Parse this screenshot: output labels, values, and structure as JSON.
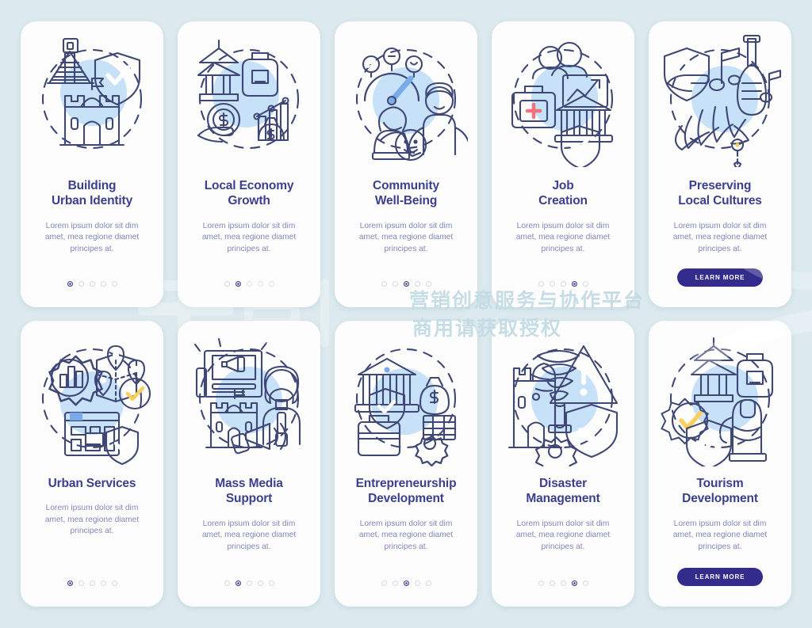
{
  "background_color": "#dceaef",
  "theme": {
    "title_color": "#3b3f8f",
    "body_color": "#8288b8",
    "button_color": "#342c8c",
    "card_color": "#fdfdfd",
    "dot_active_color": "#3b3f8f",
    "dot_inactive_color": "#d5d8e4",
    "accent_yellow": "#f9cf5e",
    "accent_blue": "#76a9ea",
    "accent_lightblue": "#bcdcf7",
    "accent_red": "#f2717a"
  },
  "body_text": "Lorem ipsum dolor sit dim\namet, mea regione diamet\nprincipes at.",
  "learn_more_label": "LEARN MORE",
  "dots_total": 5,
  "cards": [
    {
      "row": "top",
      "title": "Building\nUrban Identity",
      "icon": "pyramid-castle-shield-icon",
      "body": "Lorem ipsum dolor sit dim\namet, mea regione diamet\nprincipes at.",
      "footer_type": "dots",
      "active_dot": 1
    },
    {
      "row": "top",
      "title": "Local Economy\nGrowth",
      "icon": "pagoda-money-chart-icon",
      "body": "Lorem ipsum dolor sit dim\namet, mea regione diamet\nprincipes at.",
      "footer_type": "dots",
      "active_dot": 2
    },
    {
      "row": "top",
      "title": "Community\nWell-Being",
      "icon": "people-mood-gauge-icon",
      "body": "Lorem ipsum dolor sit dim\namet, mea regione diamet\nprincipes at.",
      "footer_type": "dots",
      "active_dot": 3
    },
    {
      "row": "top",
      "title": "Job\nCreation",
      "icon": "briefcase-bank-growth-icon",
      "body": "Lorem ipsum dolor sit dim\namet, mea regione diamet\nprincipes at.",
      "footer_type": "dots",
      "active_dot": 4
    },
    {
      "row": "top",
      "title": "Preserving\nLocal Cultures",
      "icon": "shield-music-headdress-icon",
      "body": "Lorem ipsum dolor sit dim\namet, mea regione diamet\nprincipes at.",
      "footer_type": "button",
      "button_label": "LEARN MORE"
    },
    {
      "row": "bottom",
      "title": "Urban Services",
      "icon": "gear-map-blueprint-icon",
      "body": "Lorem ipsum dolor sit dim\namet, mea regione diamet\nprincipes at.",
      "footer_type": "dots",
      "active_dot": 1
    },
    {
      "row": "bottom",
      "title": "Mass Media\nSupport",
      "icon": "newspaper-megaphone-reporter-icon",
      "body": "Lorem ipsum dolor sit dim\namet, mea regione diamet\nprincipes at.",
      "footer_type": "dots",
      "active_dot": 2
    },
    {
      "row": "bottom",
      "title": "Entrepreneurship\nDevelopment",
      "icon": "bank-moneybag-briefcase-icon",
      "body": "Lorem ipsum dolor sit dim\namet, mea regione diamet\nprincipes at.",
      "footer_type": "dots",
      "active_dot": 3
    },
    {
      "row": "bottom",
      "title": "Disaster\nManagement",
      "icon": "tornado-warning-shield-icon",
      "body": "Lorem ipsum dolor sit dim\namet, mea regione diamet\nprincipes at.",
      "footer_type": "dots",
      "active_dot": 4
    },
    {
      "row": "bottom",
      "title": "Tourism\nDevelopment",
      "icon": "pagoda-backpack-statue-gear-icon",
      "body": "Lorem ipsum dolor sit dim\namet, mea regione diamet\nprincipes at.",
      "footer_type": "button",
      "button_label": "LEARN MORE"
    }
  ],
  "watermark": {
    "logo_text": "千图",
    "line1": "营销创意服务与协作平台",
    "line2": "商用请获取授权"
  }
}
